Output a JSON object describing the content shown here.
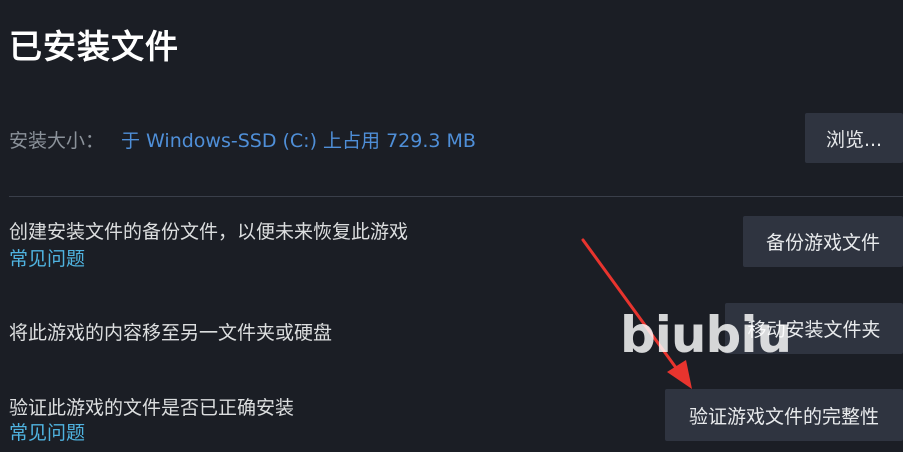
{
  "page": {
    "title": "已安装文件"
  },
  "install_size": {
    "label": "安装大小：",
    "value": "于 Windows-SSD (C:) 上占用 729.3 MB",
    "browse_label": "浏览..."
  },
  "backup": {
    "description": "创建安装文件的备份文件，以便未来恢复此游戏",
    "faq_label": "常见问题",
    "button_label": "备份游戏文件"
  },
  "move": {
    "description": "将此游戏的内容移至另一文件夹或硬盘",
    "button_label": "移动安装文件夹"
  },
  "verify": {
    "description": "验证此游戏的文件是否已正确安装",
    "faq_label": "常见问题",
    "button_label": "验证游戏文件的完整性"
  },
  "watermark": {
    "text": "biubiu"
  },
  "colors": {
    "background": "#1b1e25",
    "button": "#2f3440",
    "link": "#4fb3e0",
    "size_value": "#4f8fd8",
    "annotation_arrow": "#e8342e"
  }
}
